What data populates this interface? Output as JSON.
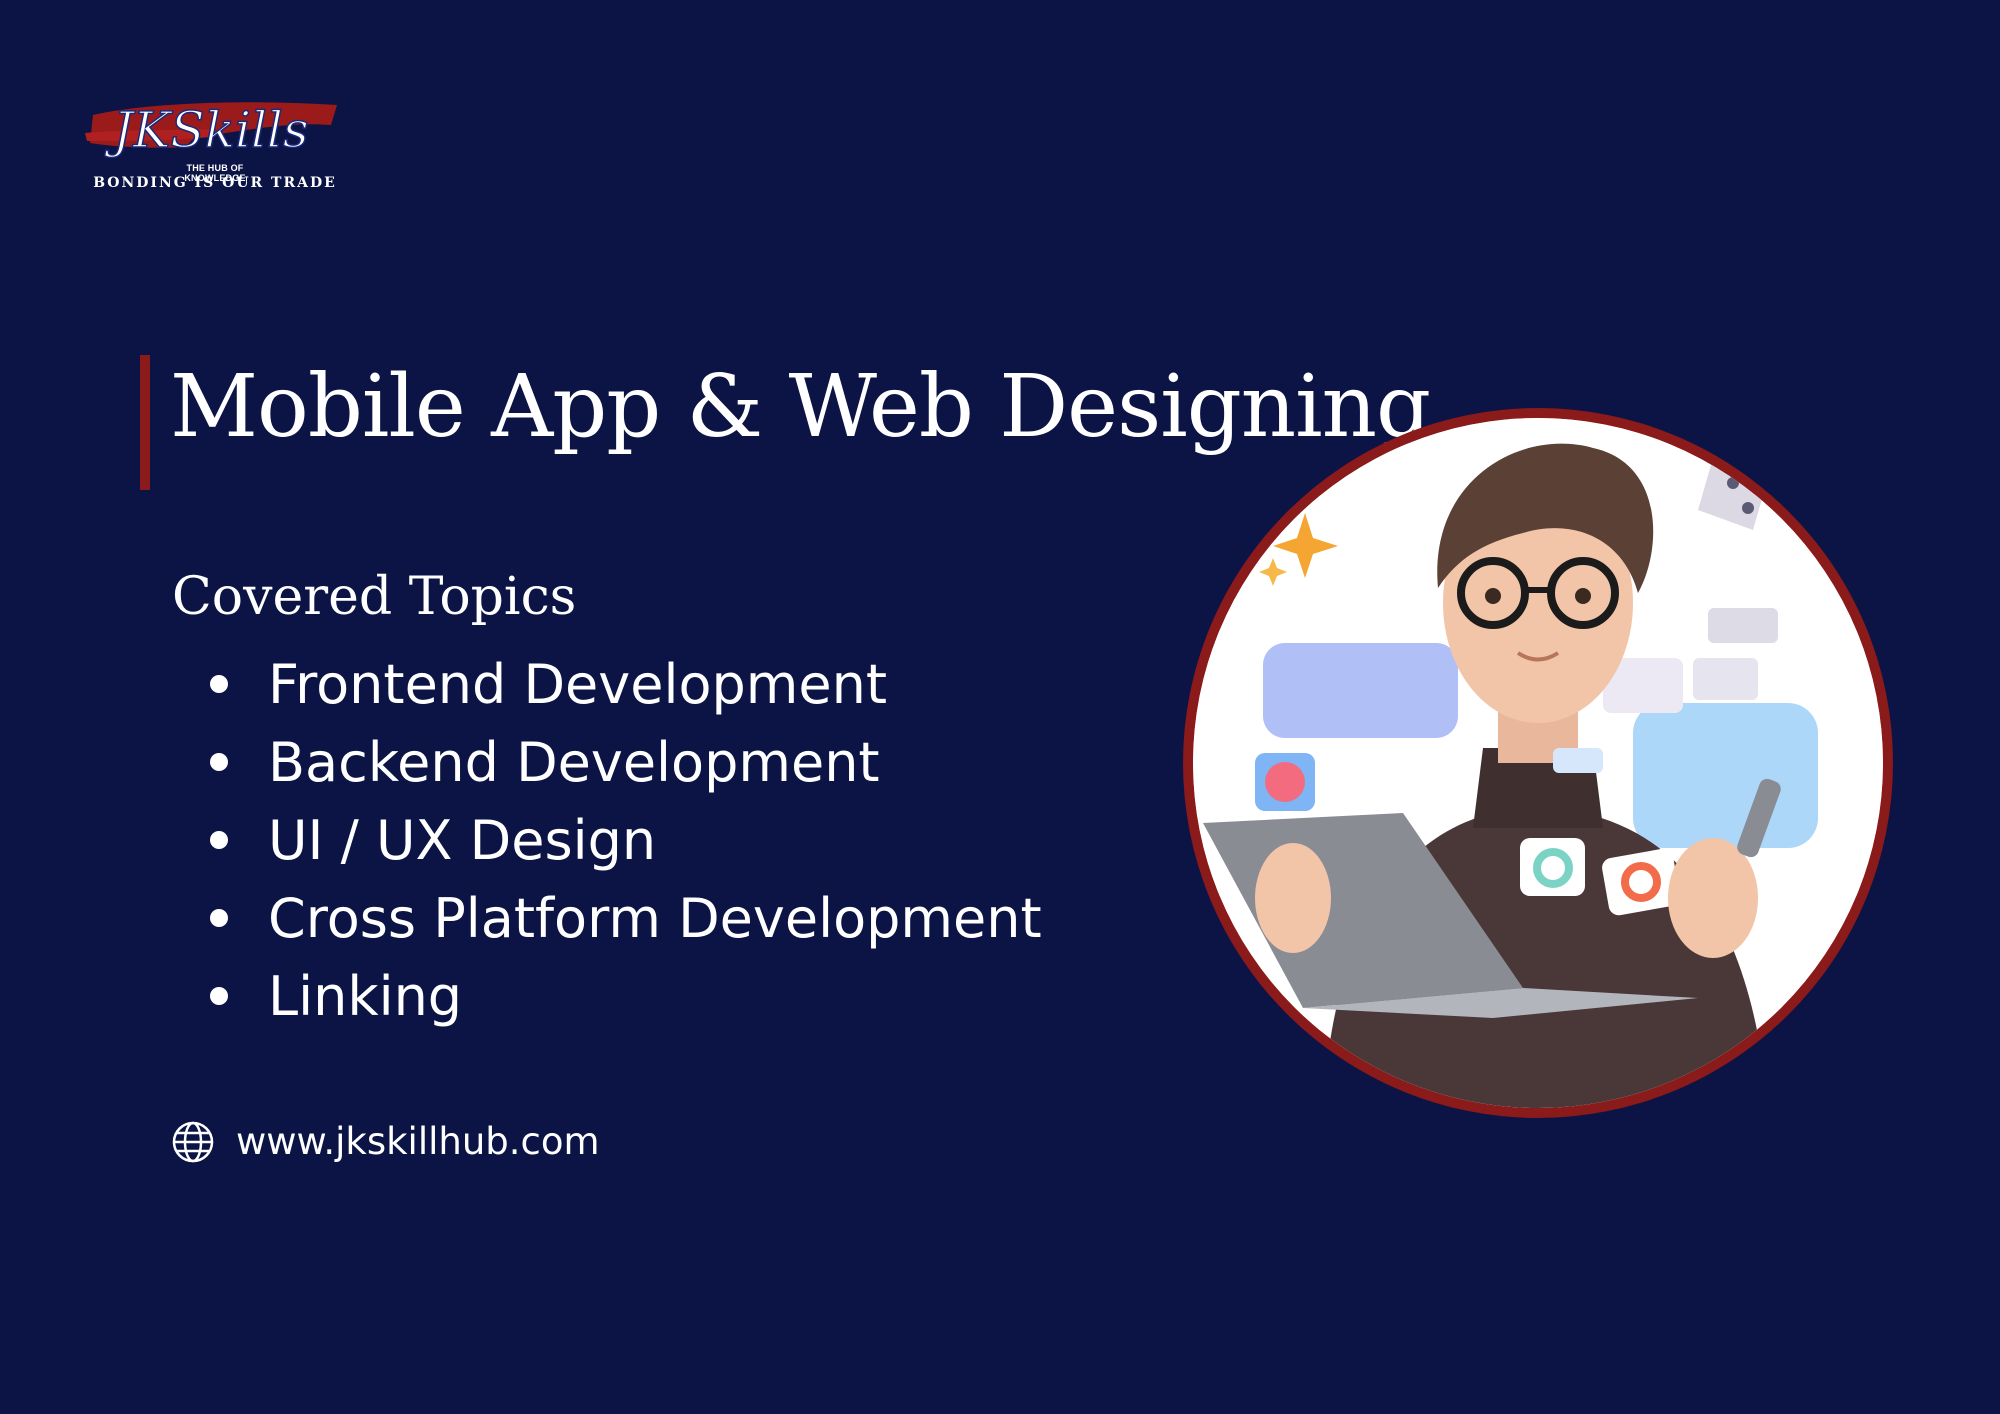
{
  "logo": {
    "wordmark": "JKSkills",
    "tagline_small": "THE HUB OF KNOWLEDGE",
    "tagline": "BONDING IS OUR TRADE"
  },
  "title": "Mobile App & Web Designing",
  "topics": {
    "heading": "Covered Topics",
    "items": [
      "Frontend Development",
      "Backend Development",
      "UI / UX Design",
      "Cross Platform Development",
      "Linking"
    ]
  },
  "website": {
    "icon": "globe-icon",
    "url": "www.jkskillhub.com"
  },
  "illustration": {
    "subject": "3d-character-with-laptop",
    "colors": {
      "ring": "#8b1a1a",
      "sweater": "#4a3838",
      "hair": "#5a4035",
      "laptop": "#8a8c94"
    }
  },
  "colors": {
    "background": "#0b1445",
    "accent": "#8b1a1a",
    "text": "#ffffff"
  }
}
